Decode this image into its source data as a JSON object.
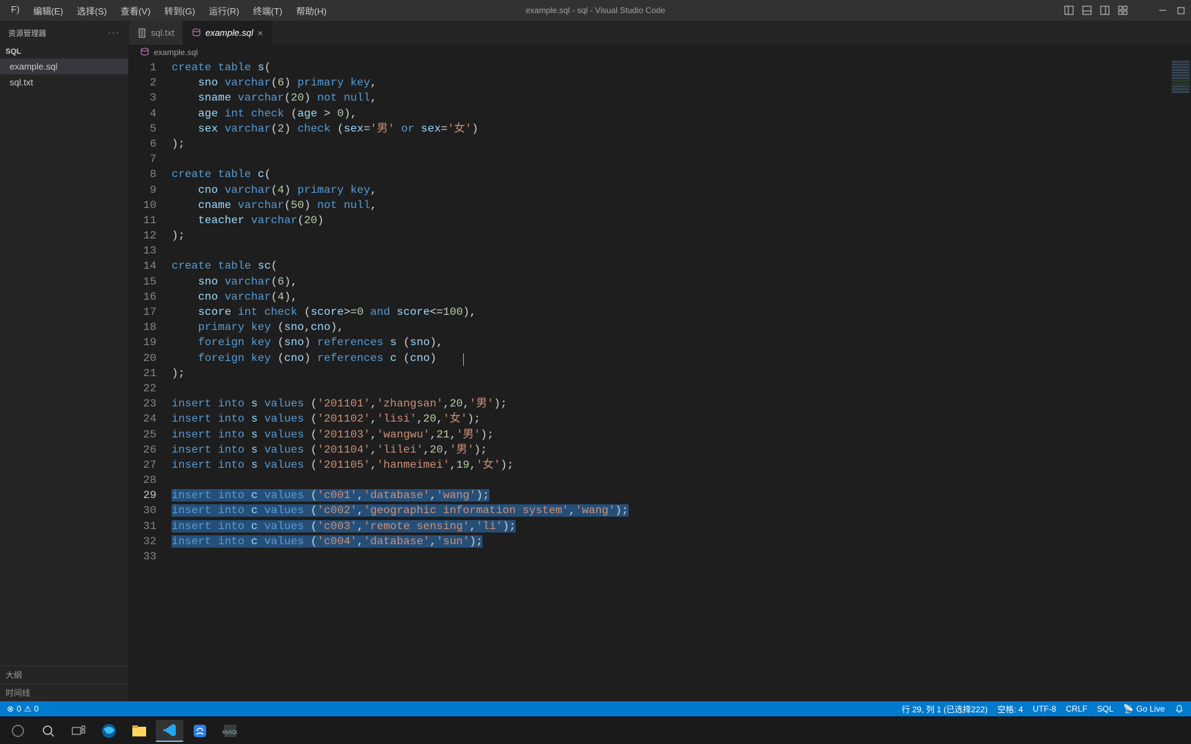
{
  "window_title": "example.sql - sql - Visual Studio Code",
  "menu": [
    "F)",
    "编辑(E)",
    "选择(S)",
    "查看(V)",
    "转到(G)",
    "运行(R)",
    "终端(T)",
    "帮助(H)"
  ],
  "sidebar": {
    "header": "资源管理器",
    "section": "SQL",
    "files": [
      {
        "name": "example.sql",
        "selected": true
      },
      {
        "name": "sql.txt",
        "selected": false
      }
    ],
    "outline": "大纲",
    "timeline": "时间线"
  },
  "tabs": [
    {
      "icon": "text",
      "label": "sql.txt",
      "active": false,
      "dirty": false
    },
    {
      "icon": "db",
      "label": "example.sql",
      "active": true,
      "dirty": false
    }
  ],
  "breadcrumb_icon": "db",
  "breadcrumb": "example.sql",
  "code_lines": [
    [
      [
        "kw",
        "create"
      ],
      [
        "sp",
        " "
      ],
      [
        "kw",
        "table"
      ],
      [
        "sp",
        " "
      ],
      [
        "ident",
        "s"
      ],
      [
        "punct",
        "("
      ]
    ],
    [
      [
        "sp",
        "    "
      ],
      [
        "ident",
        "sno"
      ],
      [
        "sp",
        " "
      ],
      [
        "type",
        "varchar"
      ],
      [
        "punct",
        "("
      ],
      [
        "num",
        "6"
      ],
      [
        "punct",
        ")"
      ],
      [
        "sp",
        " "
      ],
      [
        "kw",
        "primary"
      ],
      [
        "sp",
        " "
      ],
      [
        "kw",
        "key"
      ],
      [
        "punct",
        ","
      ]
    ],
    [
      [
        "sp",
        "    "
      ],
      [
        "ident",
        "sname"
      ],
      [
        "sp",
        " "
      ],
      [
        "type",
        "varchar"
      ],
      [
        "punct",
        "("
      ],
      [
        "num",
        "20"
      ],
      [
        "punct",
        ")"
      ],
      [
        "sp",
        " "
      ],
      [
        "kw",
        "not"
      ],
      [
        "sp",
        " "
      ],
      [
        "kw",
        "null"
      ],
      [
        "punct",
        ","
      ]
    ],
    [
      [
        "sp",
        "    "
      ],
      [
        "ident",
        "age"
      ],
      [
        "sp",
        " "
      ],
      [
        "type",
        "int"
      ],
      [
        "sp",
        " "
      ],
      [
        "kw",
        "check"
      ],
      [
        "sp",
        " "
      ],
      [
        "punct",
        "("
      ],
      [
        "ident",
        "age"
      ],
      [
        "sp",
        " "
      ],
      [
        "punct",
        ">"
      ],
      [
        "sp",
        " "
      ],
      [
        "num",
        "0"
      ],
      [
        "punct",
        ")"
      ],
      [
        "punct",
        ","
      ]
    ],
    [
      [
        "sp",
        "    "
      ],
      [
        "ident",
        "sex"
      ],
      [
        "sp",
        " "
      ],
      [
        "type",
        "varchar"
      ],
      [
        "punct",
        "("
      ],
      [
        "num",
        "2"
      ],
      [
        "punct",
        ")"
      ],
      [
        "sp",
        " "
      ],
      [
        "kw",
        "check"
      ],
      [
        "sp",
        " "
      ],
      [
        "punct",
        "("
      ],
      [
        "ident",
        "sex"
      ],
      [
        "punct",
        "="
      ],
      [
        "str",
        "'男'"
      ],
      [
        "sp",
        " "
      ],
      [
        "kw",
        "or"
      ],
      [
        "sp",
        " "
      ],
      [
        "ident",
        "sex"
      ],
      [
        "punct",
        "="
      ],
      [
        "str",
        "'女'"
      ],
      [
        "punct",
        ")"
      ]
    ],
    [
      [
        "punct",
        ");"
      ]
    ],
    [
      [
        "sp",
        ""
      ]
    ],
    [
      [
        "kw",
        "create"
      ],
      [
        "sp",
        " "
      ],
      [
        "kw",
        "table"
      ],
      [
        "sp",
        " "
      ],
      [
        "ident",
        "c"
      ],
      [
        "punct",
        "("
      ]
    ],
    [
      [
        "sp",
        "    "
      ],
      [
        "ident",
        "cno"
      ],
      [
        "sp",
        " "
      ],
      [
        "type",
        "varchar"
      ],
      [
        "punct",
        "("
      ],
      [
        "num",
        "4"
      ],
      [
        "punct",
        ")"
      ],
      [
        "sp",
        " "
      ],
      [
        "kw",
        "primary"
      ],
      [
        "sp",
        " "
      ],
      [
        "kw",
        "key"
      ],
      [
        "punct",
        ","
      ]
    ],
    [
      [
        "sp",
        "    "
      ],
      [
        "ident",
        "cname"
      ],
      [
        "sp",
        " "
      ],
      [
        "type",
        "varchar"
      ],
      [
        "punct",
        "("
      ],
      [
        "num",
        "50"
      ],
      [
        "punct",
        ")"
      ],
      [
        "sp",
        " "
      ],
      [
        "kw",
        "not"
      ],
      [
        "sp",
        " "
      ],
      [
        "kw",
        "null"
      ],
      [
        "punct",
        ","
      ]
    ],
    [
      [
        "sp",
        "    "
      ],
      [
        "ident",
        "teacher"
      ],
      [
        "sp",
        " "
      ],
      [
        "type",
        "varchar"
      ],
      [
        "punct",
        "("
      ],
      [
        "num",
        "20"
      ],
      [
        "punct",
        ")"
      ]
    ],
    [
      [
        "punct",
        ");"
      ]
    ],
    [
      [
        "sp",
        ""
      ]
    ],
    [
      [
        "kw",
        "create"
      ],
      [
        "sp",
        " "
      ],
      [
        "kw",
        "table"
      ],
      [
        "sp",
        " "
      ],
      [
        "ident",
        "sc"
      ],
      [
        "punct",
        "("
      ]
    ],
    [
      [
        "sp",
        "    "
      ],
      [
        "ident",
        "sno"
      ],
      [
        "sp",
        " "
      ],
      [
        "type",
        "varchar"
      ],
      [
        "punct",
        "("
      ],
      [
        "num",
        "6"
      ],
      [
        "punct",
        ")"
      ],
      [
        "punct",
        ","
      ]
    ],
    [
      [
        "sp",
        "    "
      ],
      [
        "ident",
        "cno"
      ],
      [
        "sp",
        " "
      ],
      [
        "type",
        "varchar"
      ],
      [
        "punct",
        "("
      ],
      [
        "num",
        "4"
      ],
      [
        "punct",
        ")"
      ],
      [
        "punct",
        ","
      ]
    ],
    [
      [
        "sp",
        "    "
      ],
      [
        "ident",
        "score"
      ],
      [
        "sp",
        " "
      ],
      [
        "type",
        "int"
      ],
      [
        "sp",
        " "
      ],
      [
        "kw",
        "check"
      ],
      [
        "sp",
        " "
      ],
      [
        "punct",
        "("
      ],
      [
        "ident",
        "score"
      ],
      [
        "punct",
        ">="
      ],
      [
        "num",
        "0"
      ],
      [
        "sp",
        " "
      ],
      [
        "kw",
        "and"
      ],
      [
        "sp",
        " "
      ],
      [
        "ident",
        "score"
      ],
      [
        "punct",
        "<="
      ],
      [
        "num",
        "100"
      ],
      [
        "punct",
        ")"
      ],
      [
        "punct",
        ","
      ]
    ],
    [
      [
        "sp",
        "    "
      ],
      [
        "kw",
        "primary"
      ],
      [
        "sp",
        " "
      ],
      [
        "kw",
        "key"
      ],
      [
        "sp",
        " "
      ],
      [
        "punct",
        "("
      ],
      [
        "ident",
        "sno"
      ],
      [
        "punct",
        ","
      ],
      [
        "ident",
        "cno"
      ],
      [
        "punct",
        ")"
      ],
      [
        "punct",
        ","
      ]
    ],
    [
      [
        "sp",
        "    "
      ],
      [
        "kw",
        "foreign"
      ],
      [
        "sp",
        " "
      ],
      [
        "kw",
        "key"
      ],
      [
        "sp",
        " "
      ],
      [
        "punct",
        "("
      ],
      [
        "ident",
        "sno"
      ],
      [
        "punct",
        ")"
      ],
      [
        "sp",
        " "
      ],
      [
        "kw",
        "references"
      ],
      [
        "sp",
        " "
      ],
      [
        "ident",
        "s"
      ],
      [
        "sp",
        " "
      ],
      [
        "punct",
        "("
      ],
      [
        "ident",
        "sno"
      ],
      [
        "punct",
        ")"
      ],
      [
        "punct",
        ","
      ]
    ],
    [
      [
        "sp",
        "    "
      ],
      [
        "kw",
        "foreign"
      ],
      [
        "sp",
        " "
      ],
      [
        "kw",
        "key"
      ],
      [
        "sp",
        " "
      ],
      [
        "punct",
        "("
      ],
      [
        "ident",
        "cno"
      ],
      [
        "punct",
        ")"
      ],
      [
        "sp",
        " "
      ],
      [
        "kw",
        "references"
      ],
      [
        "sp",
        " "
      ],
      [
        "ident",
        "c"
      ],
      [
        "sp",
        " "
      ],
      [
        "punct",
        "("
      ],
      [
        "ident",
        "cno"
      ],
      [
        "punct",
        ")"
      ]
    ],
    [
      [
        "punct",
        ");"
      ]
    ],
    [
      [
        "sp",
        ""
      ]
    ],
    [
      [
        "kw",
        "insert"
      ],
      [
        "sp",
        " "
      ],
      [
        "kw",
        "into"
      ],
      [
        "sp",
        " "
      ],
      [
        "ident",
        "s"
      ],
      [
        "sp",
        " "
      ],
      [
        "kw",
        "values"
      ],
      [
        "sp",
        " "
      ],
      [
        "punct",
        "("
      ],
      [
        "str",
        "'201101'"
      ],
      [
        "punct",
        ","
      ],
      [
        "str",
        "'zhangsan'"
      ],
      [
        "punct",
        ","
      ],
      [
        "num",
        "20"
      ],
      [
        "punct",
        ","
      ],
      [
        "str",
        "'男'"
      ],
      [
        "punct",
        ");"
      ]
    ],
    [
      [
        "kw",
        "insert"
      ],
      [
        "sp",
        " "
      ],
      [
        "kw",
        "into"
      ],
      [
        "sp",
        " "
      ],
      [
        "ident",
        "s"
      ],
      [
        "sp",
        " "
      ],
      [
        "kw",
        "values"
      ],
      [
        "sp",
        " "
      ],
      [
        "punct",
        "("
      ],
      [
        "str",
        "'201102'"
      ],
      [
        "punct",
        ","
      ],
      [
        "str",
        "'lisi'"
      ],
      [
        "punct",
        ","
      ],
      [
        "num",
        "20"
      ],
      [
        "punct",
        ","
      ],
      [
        "str",
        "'女'"
      ],
      [
        "punct",
        ");"
      ]
    ],
    [
      [
        "kw",
        "insert"
      ],
      [
        "sp",
        " "
      ],
      [
        "kw",
        "into"
      ],
      [
        "sp",
        " "
      ],
      [
        "ident",
        "s"
      ],
      [
        "sp",
        " "
      ],
      [
        "kw",
        "values"
      ],
      [
        "sp",
        " "
      ],
      [
        "punct",
        "("
      ],
      [
        "str",
        "'201103'"
      ],
      [
        "punct",
        ","
      ],
      [
        "str",
        "'wangwu'"
      ],
      [
        "punct",
        ","
      ],
      [
        "num",
        "21"
      ],
      [
        "punct",
        ","
      ],
      [
        "str",
        "'男'"
      ],
      [
        "punct",
        ");"
      ]
    ],
    [
      [
        "kw",
        "insert"
      ],
      [
        "sp",
        " "
      ],
      [
        "kw",
        "into"
      ],
      [
        "sp",
        " "
      ],
      [
        "ident",
        "s"
      ],
      [
        "sp",
        " "
      ],
      [
        "kw",
        "values"
      ],
      [
        "sp",
        " "
      ],
      [
        "punct",
        "("
      ],
      [
        "str",
        "'201104'"
      ],
      [
        "punct",
        ","
      ],
      [
        "str",
        "'lilei'"
      ],
      [
        "punct",
        ","
      ],
      [
        "num",
        "20"
      ],
      [
        "punct",
        ","
      ],
      [
        "str",
        "'男'"
      ],
      [
        "punct",
        ");"
      ]
    ],
    [
      [
        "kw",
        "insert"
      ],
      [
        "sp",
        " "
      ],
      [
        "kw",
        "into"
      ],
      [
        "sp",
        " "
      ],
      [
        "ident",
        "s"
      ],
      [
        "sp",
        " "
      ],
      [
        "kw",
        "values"
      ],
      [
        "sp",
        " "
      ],
      [
        "punct",
        "("
      ],
      [
        "str",
        "'201105'"
      ],
      [
        "punct",
        ","
      ],
      [
        "str",
        "'hanmeimei'"
      ],
      [
        "punct",
        ","
      ],
      [
        "num",
        "19"
      ],
      [
        "punct",
        ","
      ],
      [
        "str",
        "'女'"
      ],
      [
        "punct",
        ");"
      ]
    ],
    [
      [
        "sp",
        ""
      ]
    ],
    [
      [
        "kw",
        "insert"
      ],
      [
        "sp",
        " "
      ],
      [
        "kw",
        "into"
      ],
      [
        "sp",
        " "
      ],
      [
        "ident",
        "c"
      ],
      [
        "sp",
        " "
      ],
      [
        "kw",
        "values"
      ],
      [
        "sp",
        " "
      ],
      [
        "punct",
        "("
      ],
      [
        "str",
        "'c001'"
      ],
      [
        "punct",
        ","
      ],
      [
        "str",
        "'database'"
      ],
      [
        "punct",
        ","
      ],
      [
        "str",
        "'wang'"
      ],
      [
        "punct",
        ");"
      ]
    ],
    [
      [
        "kw",
        "insert"
      ],
      [
        "sp",
        " "
      ],
      [
        "kw",
        "into"
      ],
      [
        "sp",
        " "
      ],
      [
        "ident",
        "c"
      ],
      [
        "sp",
        " "
      ],
      [
        "kw",
        "values"
      ],
      [
        "sp",
        " "
      ],
      [
        "punct",
        "("
      ],
      [
        "str",
        "'c002'"
      ],
      [
        "punct",
        ","
      ],
      [
        "str",
        "'geographic information system'"
      ],
      [
        "punct",
        ","
      ],
      [
        "str",
        "'wang'"
      ],
      [
        "punct",
        ");"
      ]
    ],
    [
      [
        "kw",
        "insert"
      ],
      [
        "sp",
        " "
      ],
      [
        "kw",
        "into"
      ],
      [
        "sp",
        " "
      ],
      [
        "ident",
        "c"
      ],
      [
        "sp",
        " "
      ],
      [
        "kw",
        "values"
      ],
      [
        "sp",
        " "
      ],
      [
        "punct",
        "("
      ],
      [
        "str",
        "'c003'"
      ],
      [
        "punct",
        ","
      ],
      [
        "str",
        "'remote sensing'"
      ],
      [
        "punct",
        ","
      ],
      [
        "str",
        "'li'"
      ],
      [
        "punct",
        ");"
      ]
    ],
    [
      [
        "kw",
        "insert"
      ],
      [
        "sp",
        " "
      ],
      [
        "kw",
        "into"
      ],
      [
        "sp",
        " "
      ],
      [
        "ident",
        "c"
      ],
      [
        "sp",
        " "
      ],
      [
        "kw",
        "values"
      ],
      [
        "sp",
        " "
      ],
      [
        "punct",
        "("
      ],
      [
        "str",
        "'c004'"
      ],
      [
        "punct",
        ","
      ],
      [
        "str",
        "'database'"
      ],
      [
        "punct",
        ","
      ],
      [
        "str",
        "'sun'"
      ],
      [
        "punct",
        ");"
      ]
    ],
    [
      [
        "sp",
        ""
      ]
    ]
  ],
  "selected_rows": [
    29,
    30,
    31,
    32
  ],
  "current_line": 29,
  "status": {
    "problems_icon": "⊘",
    "problems_count": "0",
    "position": "行 29, 列 1 (已选择222)",
    "spaces": "空格: 4",
    "encoding": "UTF-8",
    "eol": "CRLF",
    "lang": "SQL",
    "golive": "Go Live"
  },
  "taskbar": [
    "start",
    "search",
    "taskview",
    "edge",
    "explorer",
    "vscode",
    "app1",
    "app2"
  ]
}
